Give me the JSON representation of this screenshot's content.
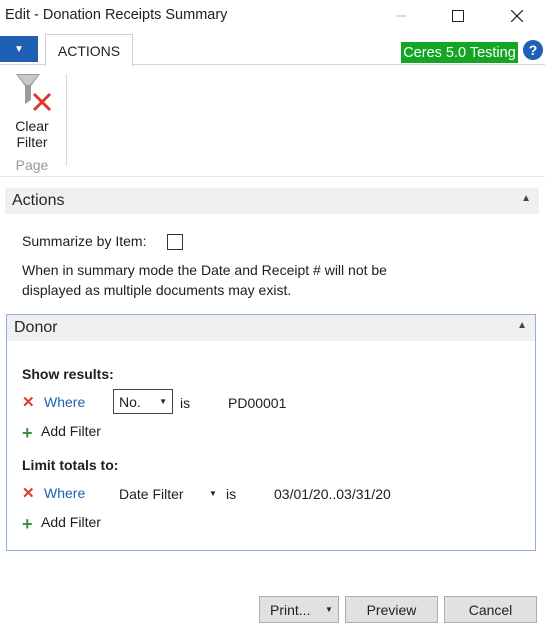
{
  "window": {
    "title": "Edit - Donation Receipts Summary",
    "minimize_icon": "minimize-icon",
    "maximize_icon": "maximize-icon",
    "close_icon": "close-icon"
  },
  "ribbon": {
    "tab_actions": "ACTIONS",
    "env_badge": "Ceres 5.0 Testing",
    "help_glyph": "?",
    "clear_filter_line1": "Clear",
    "clear_filter_line2": "Filter",
    "group_label": "Page",
    "colors": {
      "app_menu": "#1f5fb4",
      "env_badge": "#15a524"
    }
  },
  "actions_section": {
    "header": "Actions",
    "summarize_label": "Summarize by Item:",
    "summarize_checked": false,
    "note_line1": "When in summary mode the Date and Receipt # will not be",
    "note_line2": "displayed as multiple documents may exist."
  },
  "donor_section": {
    "header": "Donor",
    "show_results_label": "Show results:",
    "show_filter": {
      "where": "Where",
      "field": "No.",
      "op": "is",
      "value": "PD00001"
    },
    "add_filter_1": "Add Filter",
    "limit_totals_label": "Limit totals to:",
    "limit_filter": {
      "where": "Where",
      "field": "Date Filter",
      "op": "is",
      "value": "03/01/20..03/31/20"
    },
    "add_filter_2": "Add Filter"
  },
  "footer": {
    "print": "Print...",
    "preview": "Preview",
    "cancel": "Cancel"
  }
}
